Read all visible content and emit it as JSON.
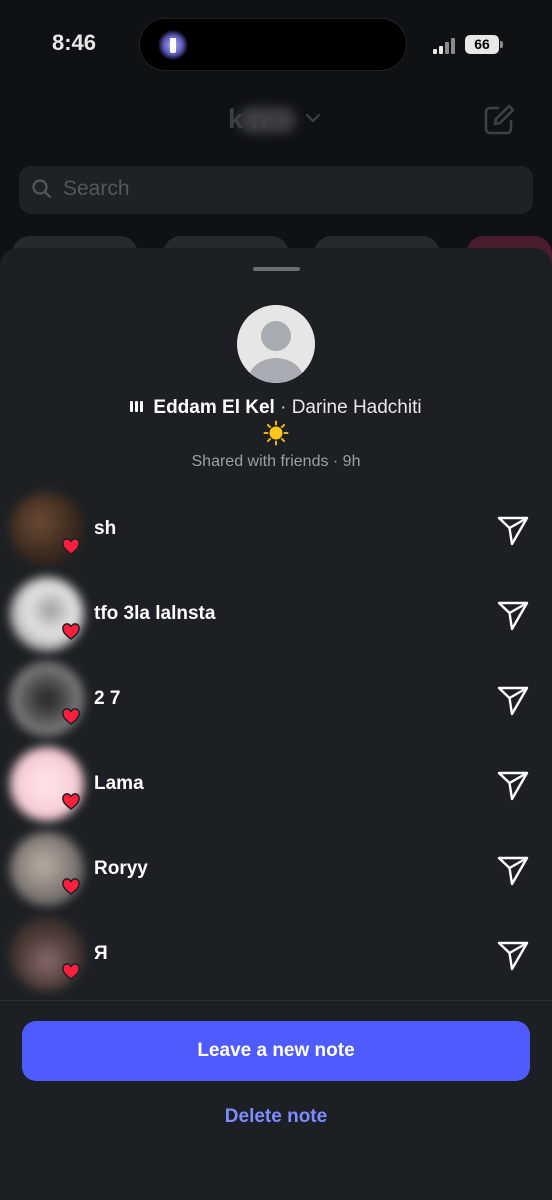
{
  "status_bar": {
    "time": "8:46",
    "battery": "66"
  },
  "background": {
    "username": "k n",
    "search_placeholder": "Search"
  },
  "note": {
    "song_title": "Eddam El Kel",
    "separator": " · ",
    "artist": "Darine Hadchiti",
    "emoji": "sun-emoji",
    "shared_text": "Shared with friends · 9h"
  },
  "likes": [
    {
      "name": "sh"
    },
    {
      "name": "tfo 3la lalnsta"
    },
    {
      "name": "2 7"
    },
    {
      "name": "Lama"
    },
    {
      "name": "Roryy"
    },
    {
      "name": "Я"
    }
  ],
  "actions": {
    "primary": "Leave a new note",
    "secondary": "Delete note"
  },
  "colors": {
    "accent": "#4e5bff",
    "link": "#7d8cff",
    "heart": "#ff1f3d",
    "sheet": "#1c2024"
  }
}
